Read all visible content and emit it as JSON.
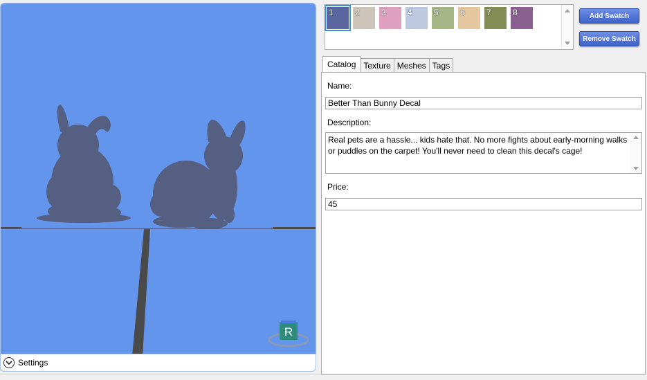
{
  "viewport": {
    "background_color": "#6495ed",
    "silhouette_color": "#555f82",
    "settings_label": "Settings",
    "gizmo_letter": "R"
  },
  "swatches": [
    {
      "number": "1",
      "color": "#5a66a0",
      "selected": true
    },
    {
      "number": "2",
      "color": "#cdc5b9",
      "selected": false
    },
    {
      "number": "3",
      "color": "#e0a0c0",
      "selected": false
    },
    {
      "number": "4",
      "color": "#bcc8e0",
      "selected": false
    },
    {
      "number": "5",
      "color": "#a5b585",
      "selected": false
    },
    {
      "number": "6",
      "color": "#e5c8a0",
      "selected": false
    },
    {
      "number": "7",
      "color": "#848c55",
      "selected": false
    },
    {
      "number": "8",
      "color": "#8a6090",
      "selected": false
    }
  ],
  "buttons": {
    "add_swatch": "Add Swatch",
    "remove_swatch": "Remove Swatch"
  },
  "tabs": [
    {
      "label": "Catalog",
      "active": true
    },
    {
      "label": "Texture",
      "active": false
    },
    {
      "label": "Meshes",
      "active": false
    },
    {
      "label": "Tags",
      "active": false
    }
  ],
  "catalog": {
    "name_label": "Name:",
    "name_value": "Better Than Bunny Decal",
    "description_label": "Description:",
    "description_value": "Real pets are a hassle... kids hate that. No more fights about early-morning walks or puddles on the carpet! You'll never need to clean this decal's cage!",
    "price_label": "Price:",
    "price_value": "45"
  }
}
